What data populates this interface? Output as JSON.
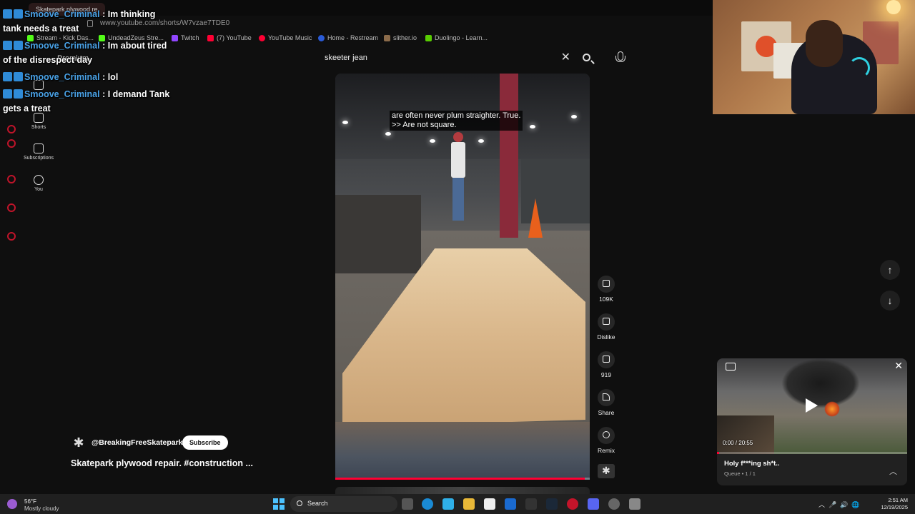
{
  "browser": {
    "tab_title": "Skatepark plywood re",
    "url": "www.youtube.com/shorts/W7vzae7TDE0",
    "bookmarks": [
      {
        "label": "Stream - Kick Das...",
        "color": "#53fc18"
      },
      {
        "label": "UndeadZeus Stre...",
        "color": "#53fc18"
      },
      {
        "label": "Twitch",
        "color": "#9146ff"
      },
      {
        "label": "(7) YouTube",
        "color": "#ff0033"
      },
      {
        "label": "YouTube Music",
        "color": "#ff0033"
      },
      {
        "label": "Home - Restream",
        "color": "#2a5bd7"
      },
      {
        "label": "slither.io",
        "color": "#8b6b4a"
      },
      {
        "label": "Duolingo - Learn...",
        "color": "#58cc02"
      }
    ]
  },
  "chat": [
    {
      "user": "Smoove_Criminal",
      "msg": ": Im thinking",
      "cont": "tank needs a treat"
    },
    {
      "user": "Smoove_Criminal",
      "msg": ": Im about tired",
      "cont": "of the disrespect day"
    },
    {
      "user": "Smoove_Criminal",
      "msg": ": lol",
      "cont": ""
    },
    {
      "user": "Smoove_Criminal",
      "msg": ": I demand Tank",
      "cont": "gets a treat"
    }
  ],
  "yt": {
    "premium_label": "Premium",
    "search_query": "skeeter jean",
    "sidebar": [
      {
        "label": "Shorts",
        "icon": "shorts-icon"
      },
      {
        "label": "Subscriptions",
        "icon": "subscriptions-icon"
      },
      {
        "label": "You",
        "icon": "you-icon"
      }
    ]
  },
  "video": {
    "caption_line1": "are often never plum straighter. True.",
    "caption_line2": ">> Are not square.",
    "progress": 0.98
  },
  "actions": {
    "like_count": "109K",
    "dislike_label": "Dislike",
    "comment_count": "919",
    "share_label": "Share",
    "remix_label": "Remix"
  },
  "channel": {
    "handle": "@BreakingFreeSkatepark",
    "subscribe_label": "Subscribe",
    "title": "Skatepark plywood repair.  #construction ..."
  },
  "nav": {
    "up_icon": "arrow-up-icon",
    "down_icon": "arrow-down-icon"
  },
  "miniplayer": {
    "time": "0:00 / 20:55",
    "title": "Holy f***ing sh*t..",
    "queue": "Queue • 1 / 1",
    "progress": 0.0
  },
  "taskbar": {
    "temp": "56°F",
    "weather": "Mostly cloudy",
    "search_label": "Search",
    "time": "2:51 AM",
    "date": "12/19/2025"
  },
  "colors": {
    "accent": "#ff0033",
    "chat_username": "#4aa3e8",
    "background": "#0f0f0f"
  }
}
